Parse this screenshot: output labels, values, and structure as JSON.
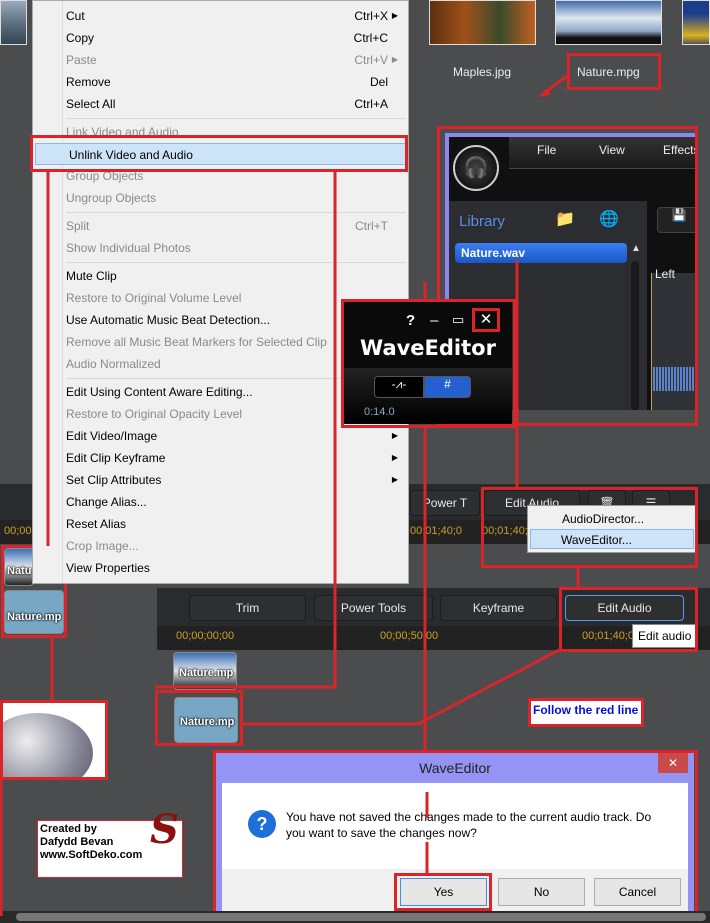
{
  "media_library": {
    "items": [
      {
        "label": "Maples.jpg"
      },
      {
        "label": "Nature.mpg"
      }
    ]
  },
  "context_menu": {
    "items": [
      {
        "label": "Cut",
        "shortcut": "Ctrl+X",
        "arrow": true
      },
      {
        "label": "Copy",
        "shortcut": "Ctrl+C"
      },
      {
        "label": "Paste",
        "shortcut": "Ctrl+V",
        "arrow": true,
        "disabled": true
      },
      {
        "label": "Remove",
        "shortcut": "Del"
      },
      {
        "label": "Select All",
        "shortcut": "Ctrl+A"
      },
      {
        "sep": true
      },
      {
        "label": "Link Video and Audio",
        "disabled": true
      },
      {
        "label": "Unlink Video and Audio",
        "highlight": true
      },
      {
        "label": "Group Objects",
        "disabled": true
      },
      {
        "label": "Ungroup Objects",
        "disabled": true
      },
      {
        "sep": true
      },
      {
        "label": "Split",
        "shortcut": "Ctrl+T",
        "disabled": true
      },
      {
        "label": "Show Individual Photos",
        "disabled": true
      },
      {
        "sep": true
      },
      {
        "label": "Mute Clip"
      },
      {
        "label": "Restore to Original Volume Level",
        "disabled": true
      },
      {
        "label": "Use Automatic Music Beat Detection..."
      },
      {
        "label": "Remove all Music Beat Markers for Selected Clip",
        "disabled": true
      },
      {
        "label": "Audio Normalized",
        "disabled": true
      },
      {
        "sep": true
      },
      {
        "label": "Edit Using Content Aware Editing..."
      },
      {
        "label": "Restore to Original Opacity Level",
        "disabled": true
      },
      {
        "label": "Edit Video/Image",
        "arrow": true
      },
      {
        "label": "Edit Clip Keyframe",
        "arrow": true
      },
      {
        "label": "Set Clip Attributes",
        "arrow": true
      },
      {
        "label": "Change Alias..."
      },
      {
        "label": "Reset Alias"
      },
      {
        "label": "Crop Image...",
        "disabled": true
      },
      {
        "label": "View Properties"
      }
    ]
  },
  "audiodirector": {
    "menu": [
      "File",
      "View",
      "Effects"
    ],
    "library_label": "Library",
    "file": "Nature.wav",
    "channel": "Left"
  },
  "waveeditor_mini": {
    "title": "WaveEditor",
    "help": "?",
    "time": "0:14.0"
  },
  "toolbar_top": {
    "power_tools": "Power T",
    "edit_audio": "Edit Audio",
    "ruler": [
      "00;00",
      "00;01;40;0",
      "00;01;40;"
    ]
  },
  "edit_audio_menu": [
    "AudioDirector...",
    "WaveEditor..."
  ],
  "toolbar": {
    "trim": "Trim",
    "power_tools": "Power Tools",
    "keyframe": "Keyframe",
    "edit_audio": "Edit Audio",
    "tooltip": "Edit audio"
  },
  "ruler": [
    "00;00;00;00",
    "00;00;50;00",
    "00;01;40;0"
  ],
  "clips": {
    "video": "Nature.mp",
    "audio": "Nature.mp",
    "left_video": "Natu",
    "left_audio": "Nature.mp"
  },
  "note": "Follow the red line",
  "credit": {
    "line1": "Created by",
    "line2": "Dafydd Bevan",
    "line3": "www.SoftDeko.com"
  },
  "dialog": {
    "title": "WaveEditor",
    "message": "You have not saved the changes made to the current audio track. Do you want to save the changes now?",
    "yes": "Yes",
    "no": "No",
    "cancel": "Cancel"
  },
  "colors": {
    "annotation_red": "#d9252a",
    "dialog_frame": "#9494f4",
    "accent_blue": "#1e6fd9"
  }
}
